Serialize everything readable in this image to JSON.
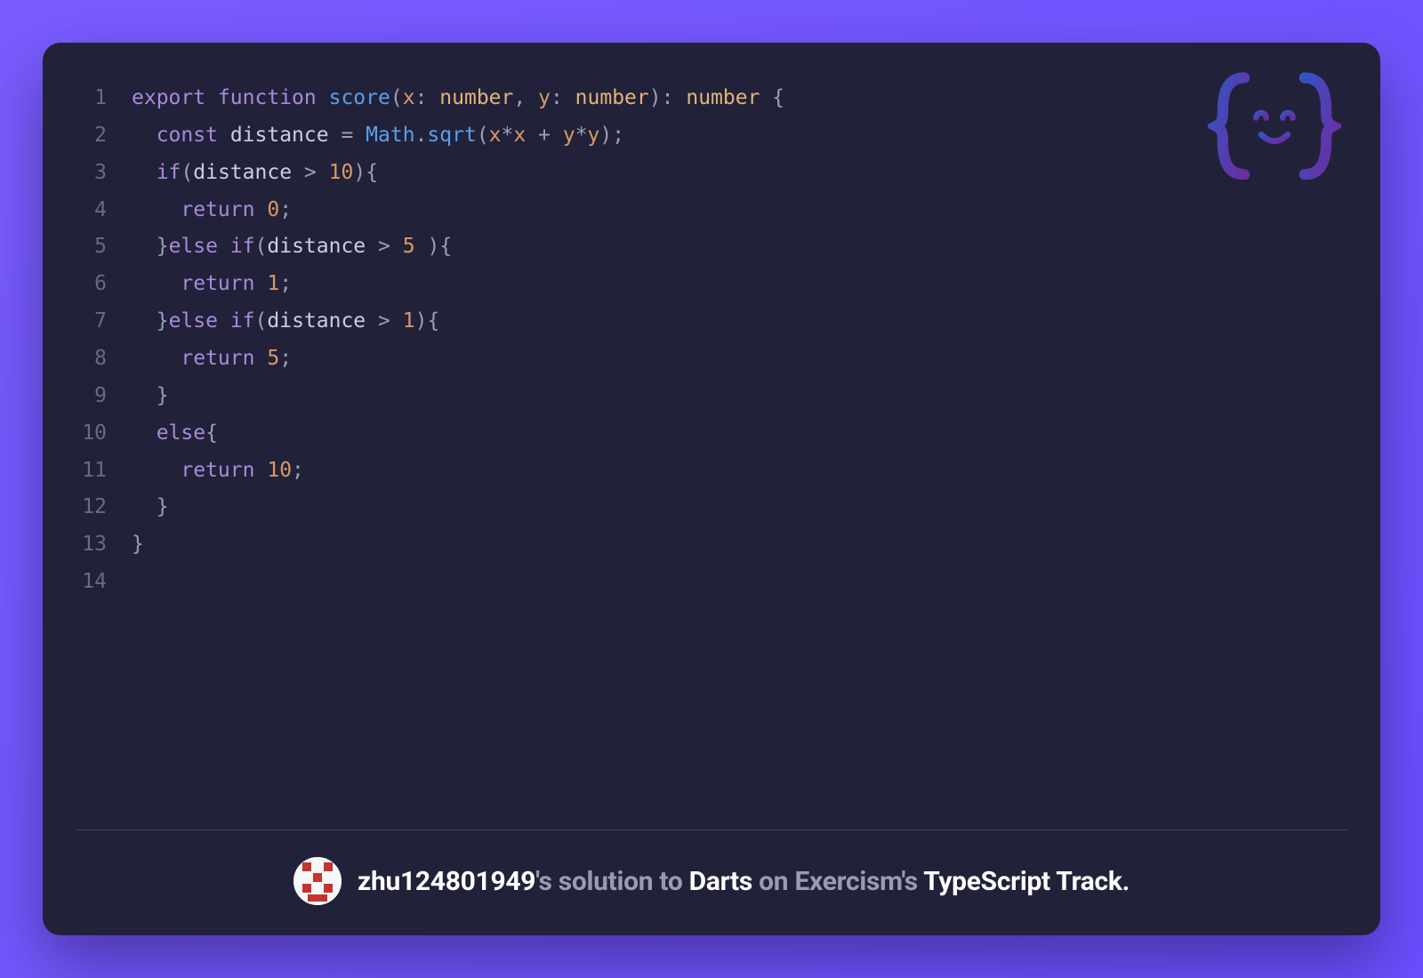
{
  "card": {
    "language": "TypeScript"
  },
  "code": {
    "line_count": 14,
    "lines": [
      "export function score(x: number, y: number): number {",
      "  const distance = Math.sqrt(x*x + y*y);",
      "  if(distance > 10){",
      "    return 0;",
      "  }else if(distance > 5 ){",
      "    return 1;",
      "  }else if(distance > 1){",
      "    return 5;",
      "  }",
      "  else{",
      "    return 10;",
      "  }",
      "}",
      ""
    ]
  },
  "footer": {
    "username": "zhu124801949",
    "middle1": "'s solution to ",
    "exercise": "Darts",
    "middle2": " on Exercism's ",
    "track": "TypeScript Track."
  },
  "colors": {
    "bg_gradient_from": "#7a5cff",
    "bg_gradient_to": "#6b4eff",
    "card_bg": "#22213a",
    "keyword": "#a78bda",
    "function": "#5aa0e6",
    "type": "#e0b577",
    "param": "#d89a63",
    "number": "#d89a63",
    "punct": "#9aa0b5",
    "gutter": "#6a6984",
    "footer_dim": "#9b9ab3",
    "footer_strong": "#ffffff"
  }
}
